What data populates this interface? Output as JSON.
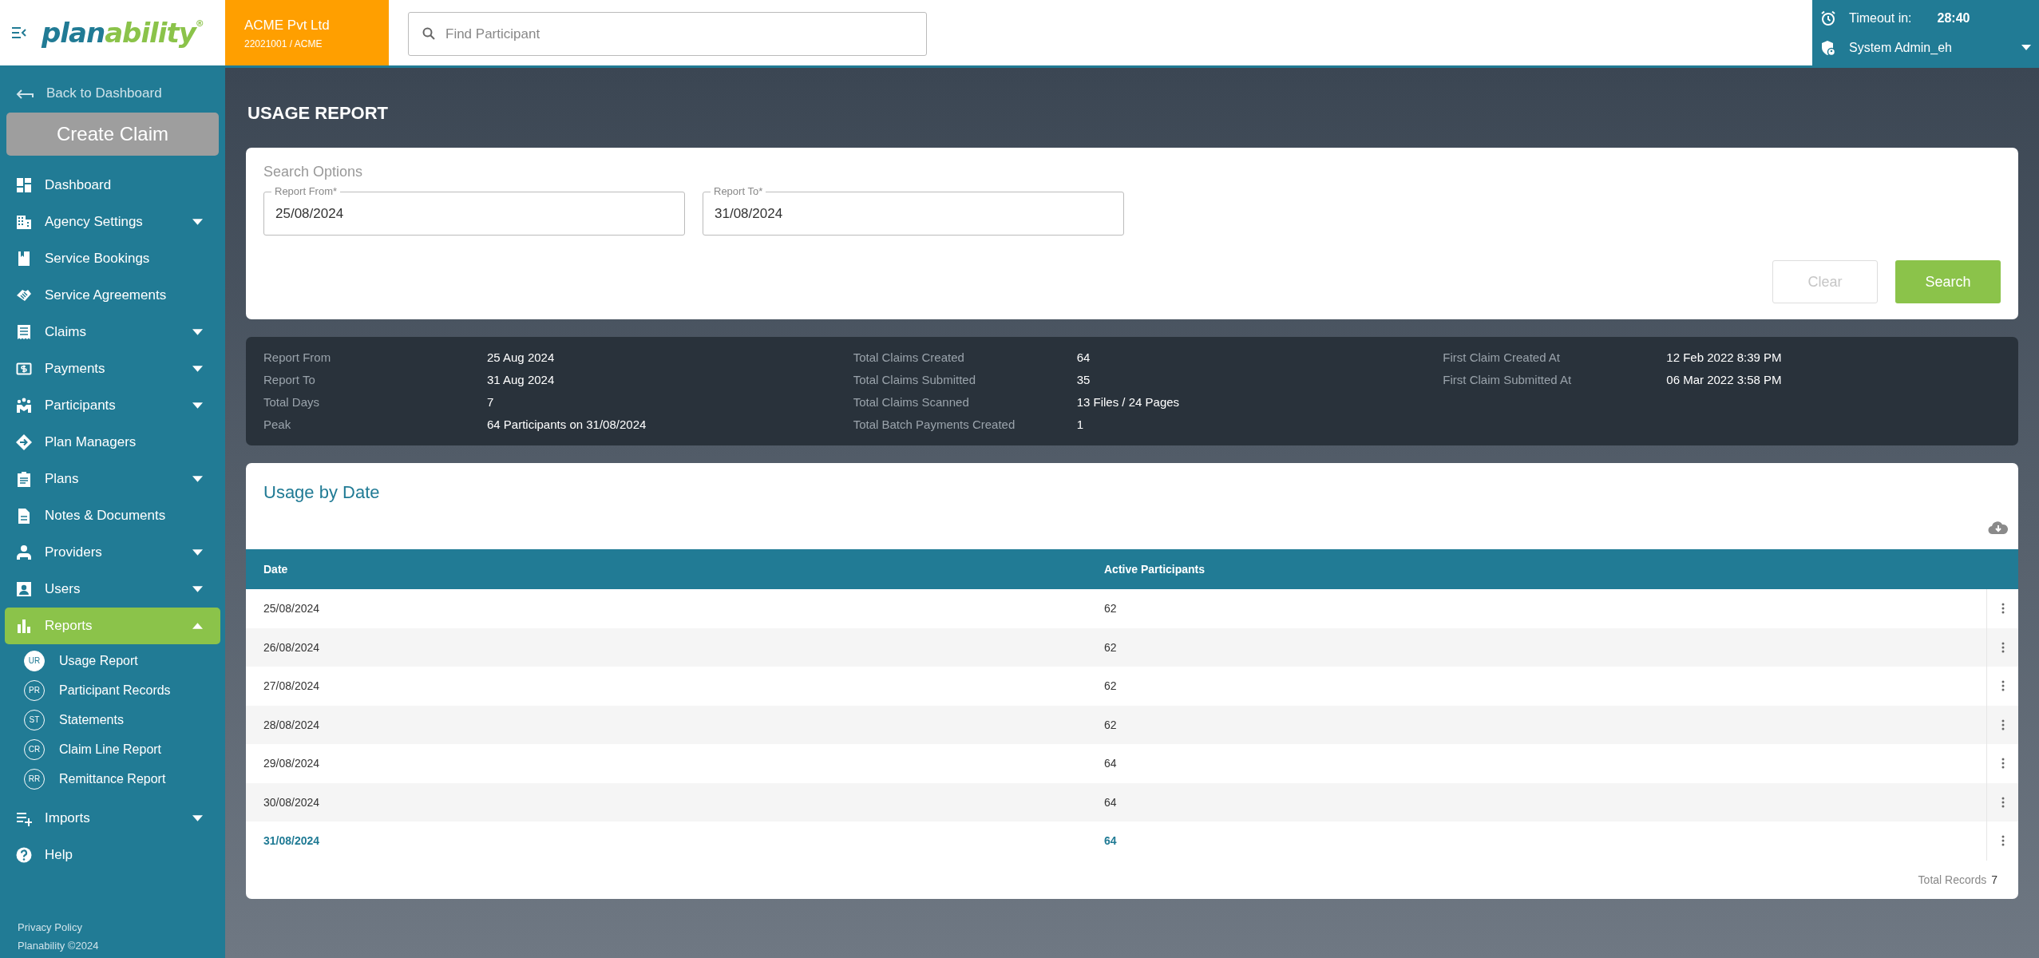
{
  "logo": {
    "first": "plan",
    "second": "ability",
    "mark": "®"
  },
  "organization": {
    "name": "ACME Pvt Ltd",
    "code": "22021001 / ACME"
  },
  "search": {
    "placeholder": "Find Participant"
  },
  "session": {
    "timeout_label": "Timeout in:",
    "timeout": "28:40",
    "user": "System Admin_eh"
  },
  "sidebar": {
    "back": "Back to Dashboard",
    "create_button": "Create Claim",
    "items": [
      {
        "kind": "dashboard",
        "label": "Dashboard",
        "selected": false
      },
      {
        "kind": "building",
        "label": "Agency Settings",
        "expanded": false,
        "selected": false
      },
      {
        "kind": "book",
        "label": "Service Bookings",
        "selected": false
      },
      {
        "kind": "handshake",
        "label": "Service Agreements",
        "selected": false
      },
      {
        "kind": "receipt",
        "label": "Claims",
        "expanded": false,
        "selected": false
      },
      {
        "kind": "money",
        "label": "Payments",
        "expanded": false,
        "selected": false
      },
      {
        "kind": "people",
        "label": "Participants",
        "expanded": false,
        "selected": false
      },
      {
        "kind": "direction",
        "label": "Plan Managers",
        "selected": false
      },
      {
        "kind": "clipboard",
        "label": "Plans",
        "expanded": false,
        "selected": false
      },
      {
        "kind": "document",
        "label": "Notes & Documents",
        "selected": false
      },
      {
        "kind": "person",
        "label": "Providers",
        "expanded": false,
        "selected": false
      },
      {
        "kind": "badge",
        "label": "Users",
        "expanded": false,
        "selected": false
      },
      {
        "kind": "chart",
        "label": "Reports",
        "expanded": true,
        "selected": true,
        "children": [
          {
            "initials": "UR",
            "label": "Usage Report",
            "selected": true
          },
          {
            "initials": "PR",
            "label": "Participant Records",
            "selected": false
          },
          {
            "initials": "ST",
            "label": "Statements",
            "selected": false
          },
          {
            "initials": "CR",
            "label": "Claim Line Report",
            "selected": false
          },
          {
            "initials": "RR",
            "label": "Remittance Report",
            "selected": false
          }
        ]
      },
      {
        "kind": "playlist",
        "label": "Imports",
        "expanded": false,
        "selected": false
      },
      {
        "kind": "help",
        "label": "Help",
        "selected": false
      }
    ],
    "footer": [
      "Privacy Policy",
      "Planability ©2024"
    ]
  },
  "page_title": "USAGE REPORT",
  "search_options": {
    "title": "Search Options",
    "fields": [
      {
        "label": "Report From*",
        "value": "25/08/2024"
      },
      {
        "label": "Report To*",
        "value": "31/08/2024"
      }
    ],
    "buttons": [
      {
        "label": "Clear",
        "kind": "secondary",
        "disabled": true
      },
      {
        "label": "Search",
        "kind": "primary",
        "disabled": false
      }
    ]
  },
  "summary": {
    "columns": [
      {
        "items": [
          {
            "label": "Report From",
            "value": "25 Aug 2024"
          },
          {
            "label": "Report To",
            "value": "31 Aug 2024"
          },
          {
            "label": "Total Days",
            "value": "7"
          },
          {
            "label": "Peak",
            "value": "64 Participants on 31/08/2024"
          }
        ]
      },
      {
        "items": [
          {
            "label": "Total Claims Created",
            "value": "64"
          },
          {
            "label": "Total Claims Submitted",
            "value": "35"
          },
          {
            "label": "Total Claims Scanned",
            "value": "13 Files / 24 Pages"
          },
          {
            "label": "Total Batch Payments Created",
            "value": "1"
          }
        ]
      },
      {
        "items": [
          {
            "label": "First Claim Created At",
            "value": "12 Feb 2022 8:39 PM"
          },
          {
            "label": "First Claim Submitted At",
            "value": "06 Mar 2022 3:58 PM"
          }
        ]
      }
    ]
  },
  "usage": {
    "title": "Usage by Date",
    "columns": [
      "Date",
      "Active Participants"
    ],
    "rows": [
      {
        "cells": [
          "25/08/2024",
          "62"
        ],
        "selected": false
      },
      {
        "cells": [
          "26/08/2024",
          "62"
        ],
        "selected": false
      },
      {
        "cells": [
          "27/08/2024",
          "62"
        ],
        "selected": false
      },
      {
        "cells": [
          "28/08/2024",
          "62"
        ],
        "selected": false
      },
      {
        "cells": [
          "29/08/2024",
          "64"
        ],
        "selected": false
      },
      {
        "cells": [
          "30/08/2024",
          "64"
        ],
        "selected": false
      },
      {
        "cells": [
          "31/08/2024",
          "64"
        ],
        "selected": true
      }
    ],
    "total_label": "Total Records",
    "total": "7"
  }
}
